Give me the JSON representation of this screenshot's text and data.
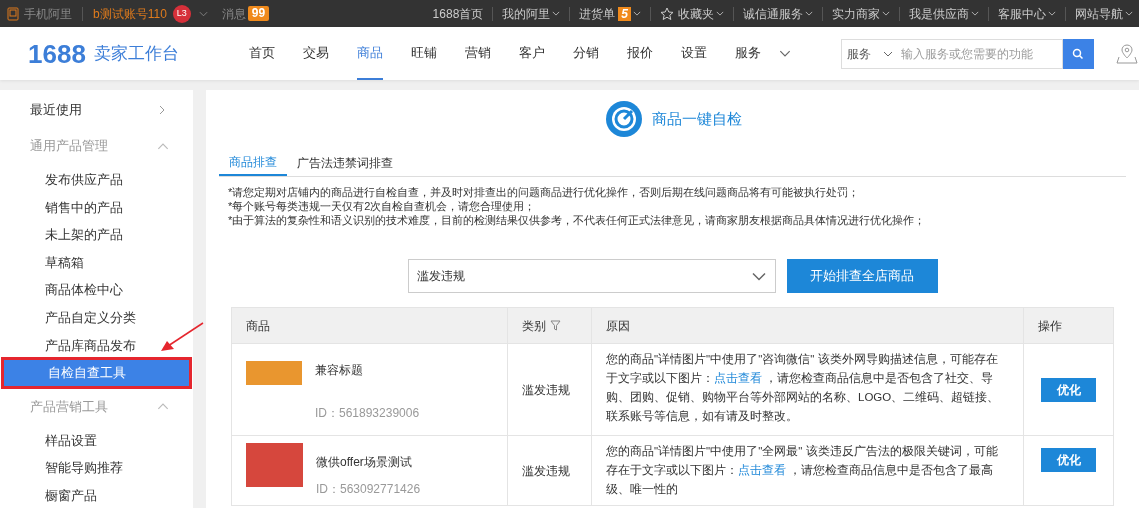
{
  "top_bar": {
    "mobile_label": "手机阿里",
    "account": "b测试账号110",
    "level": "L3",
    "messages_label": "消息",
    "messages_count": "99",
    "links": [
      {
        "label": "1688首页",
        "kind": "link"
      },
      {
        "label": "我的阿里",
        "kind": "menu"
      },
      {
        "label": "进货单",
        "kind": "badge_menu",
        "badge": "5"
      },
      {
        "label": "收藏夹",
        "kind": "star_menu"
      },
      {
        "label": "诚信通服务",
        "kind": "menu"
      },
      {
        "label": "实力商家",
        "kind": "menu"
      },
      {
        "label": "我是供应商",
        "kind": "menu"
      },
      {
        "label": "客服中心",
        "kind": "menu"
      },
      {
        "label": "网站导航",
        "kind": "menu"
      }
    ]
  },
  "header": {
    "brand_number": "1688",
    "brand_title": "卖家工作台",
    "nav": [
      {
        "label": "首页",
        "selected": false
      },
      {
        "label": "交易",
        "selected": false
      },
      {
        "label": "商品",
        "selected": true
      },
      {
        "label": "旺铺",
        "selected": false
      },
      {
        "label": "营销",
        "selected": false
      },
      {
        "label": "客户",
        "selected": false
      },
      {
        "label": "分销",
        "selected": false
      },
      {
        "label": "报价",
        "selected": false
      },
      {
        "label": "设置",
        "selected": false
      },
      {
        "label": "服务",
        "selected": false
      }
    ],
    "search": {
      "scope": "服务",
      "placeholder": "输入服务或您需要的功能"
    }
  },
  "sidebar": [
    {
      "kind": "recent",
      "label": "最近使用"
    },
    {
      "kind": "group",
      "label": "通用产品管理",
      "expanded": true,
      "children": [
        {
          "label": "发布供应产品",
          "selected": false
        },
        {
          "label": "销售中的产品",
          "selected": false
        },
        {
          "label": "未上架的产品",
          "selected": false
        },
        {
          "label": "草稿箱",
          "selected": false
        },
        {
          "label": "商品体检中心",
          "selected": false
        },
        {
          "label": "产品自定义分类",
          "selected": false
        },
        {
          "label": "产品库商品发布",
          "selected": false
        },
        {
          "label": "自检自查工具",
          "selected": true
        }
      ]
    },
    {
      "kind": "group",
      "label": "产品营销工具",
      "expanded": true,
      "children": [
        {
          "label": "样品设置",
          "selected": false
        },
        {
          "label": "智能导购推荐",
          "selected": false
        },
        {
          "label": "橱窗产品",
          "selected": false
        }
      ]
    }
  ],
  "main": {
    "title": "商品一键自检",
    "tabs": [
      {
        "label": "商品排查",
        "selected": true
      },
      {
        "label": "广告法违禁词排查",
        "selected": false
      }
    ],
    "notices": [
      "*请您定期对店铺内的商品进行自检自查，并及时对排查出的问题商品进行优化操作，否则后期在线问题商品将有可能被执行处罚；",
      "*每个账号每类违规一天仅有2次自检自查机会，请您合理使用；",
      "*由于算法的复杂性和语义识别的技术难度，目前的检测结果仅供参考，不代表任何正式法律意见，请商家朋友根据商品具体情况进行优化操作；"
    ],
    "filter": {
      "value": "滥发违规",
      "button": "开始排查全店商品"
    },
    "table": {
      "columns": [
        "商品",
        "类别",
        "原因",
        "操作"
      ],
      "rows": [
        {
          "title": "兼容标题",
          "id": "ID：561893239006",
          "category": "滥发违规",
          "reason_before": "您的商品\"详情图片\"中使用了\"咨询微信\" 该类外网导购描述信息，可能存在于文字或以下图片：",
          "reason_link": "点击查看",
          "reason_after": " ，请您检查商品信息中是否包含了社交、导购、团购、促销、购物平台等外部网站的名称、LOGO、二维码、超链接、联系账号等信息，如有请及时整改。",
          "action": "优化"
        },
        {
          "title": "微供offer场景测试",
          "id": "ID：563092771426",
          "category": "滥发违规",
          "reason_before": "您的商品\"详情图片\"中使用了\"全网最\" 该类违反广告法的极限关键词，可能存在于文字或以下图片：",
          "reason_link": "点击查看",
          "reason_after": " ，请您检查商品信息中是否包含了最高级、唯一性的",
          "action": "优化"
        }
      ]
    }
  }
}
